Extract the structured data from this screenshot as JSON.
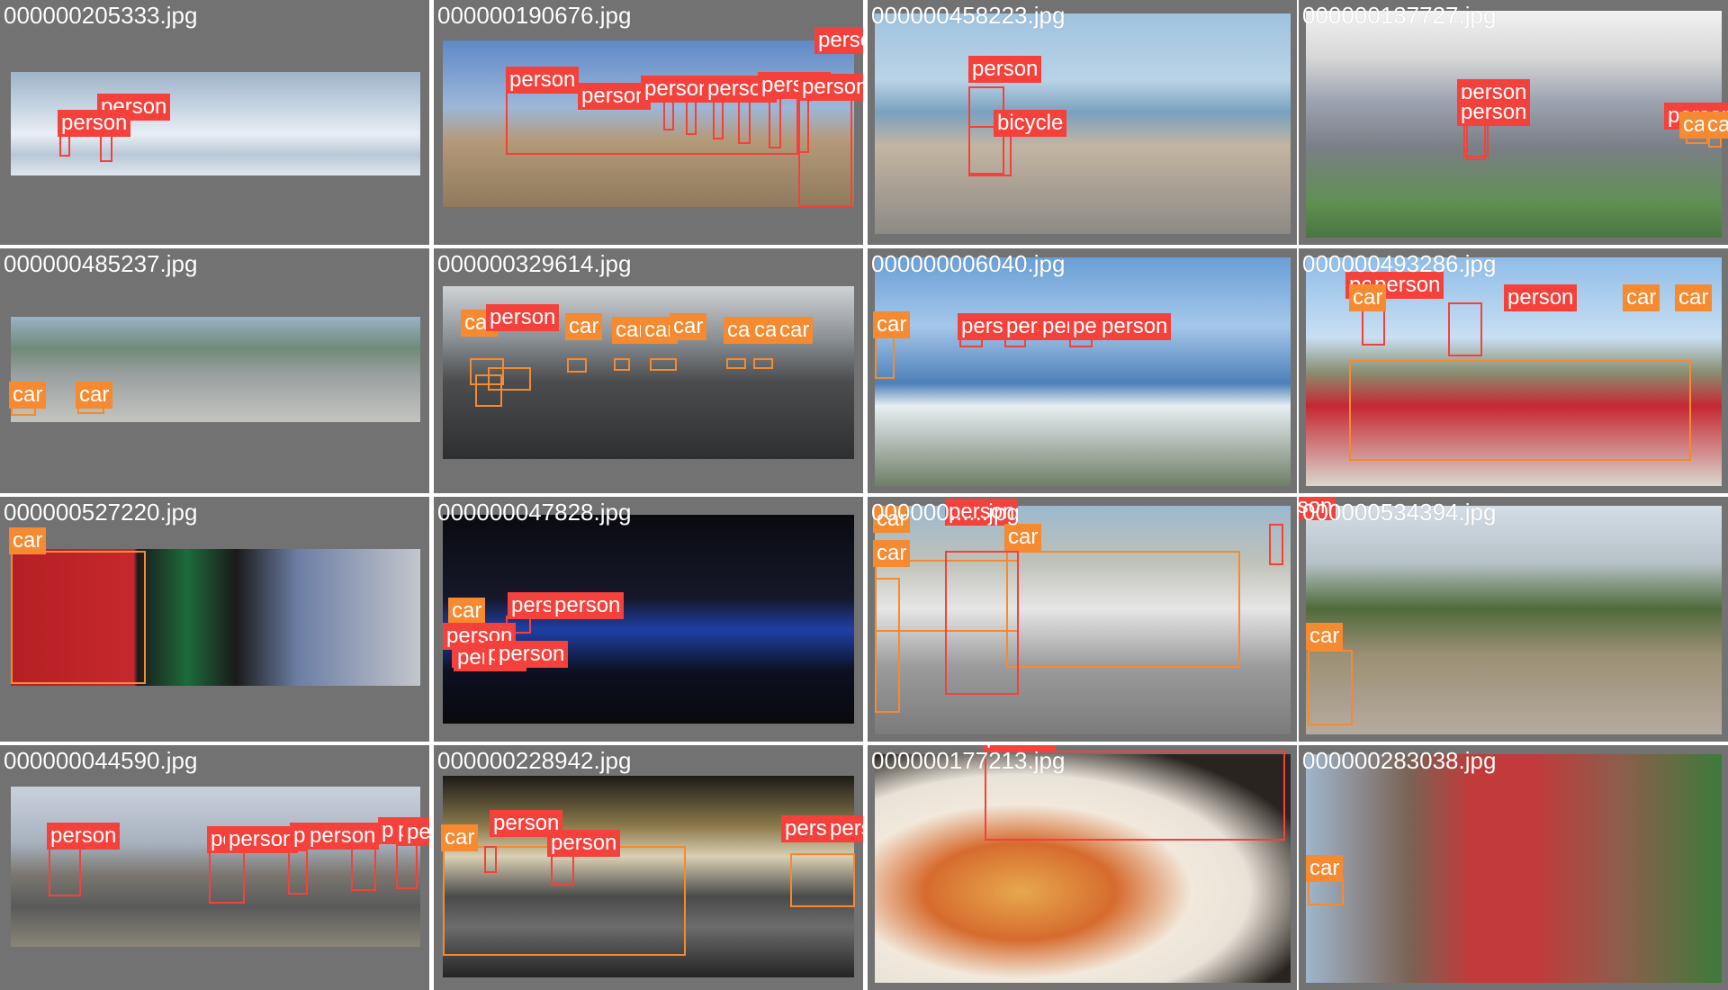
{
  "mosaic": {
    "tiles": [
      {
        "filename": "000000205333.jpg",
        "labels": [
          "person",
          "person"
        ]
      },
      {
        "filename": "000000190676.jpg",
        "labels": [
          "person",
          "person",
          "person",
          "person",
          "person",
          "person",
          "person",
          "person",
          "person",
          "person"
        ]
      },
      {
        "filename": "000000458223.jpg",
        "labels": [
          "person",
          "bicycle"
        ]
      },
      {
        "filename": "000000137727.jpg",
        "labels": [
          "person",
          "person",
          "person",
          "car",
          "car"
        ]
      },
      {
        "filename": "000000485237.jpg",
        "labels": [
          "car",
          "car"
        ]
      },
      {
        "filename": "000000329614.jpg",
        "labels": [
          "car",
          "person",
          "car",
          "car",
          "car",
          "car",
          "car",
          "car",
          "car"
        ]
      },
      {
        "filename": "000000006040.jpg",
        "labels": [
          "car",
          "person",
          "person",
          "person",
          "person",
          "person"
        ]
      },
      {
        "filename": "000000493286.jpg",
        "labels": [
          "car",
          "person",
          "person",
          "person",
          "car",
          "car"
        ]
      },
      {
        "filename": "000000527220.jpg",
        "labels": [
          "car"
        ]
      },
      {
        "filename": "000000047828.jpg",
        "labels": [
          "car",
          "person",
          "person",
          "person",
          "person",
          "person",
          "person"
        ]
      },
      {
        "filename": "000000......jpg",
        "labels": [
          "car",
          "person",
          "car",
          "car",
          "person"
        ]
      },
      {
        "filename": "000000534394.jpg",
        "labels": [
          "car"
        ]
      },
      {
        "filename": "000000044590.jpg",
        "labels": [
          "person",
          "person",
          "person",
          "person",
          "person",
          "person",
          "person",
          "person"
        ]
      },
      {
        "filename": "000000228942.jpg",
        "labels": [
          "car",
          "person",
          "person",
          "person",
          "person"
        ]
      },
      {
        "filename": "000000177213.jpg",
        "labels": [
          "person"
        ]
      },
      {
        "filename": "000000283038.jpg",
        "labels": [
          "car"
        ]
      }
    ]
  },
  "colors": {
    "tile_background": "#727272",
    "person": "#f4413b",
    "car": "#f58a31",
    "bicycle": "#f4413b"
  }
}
